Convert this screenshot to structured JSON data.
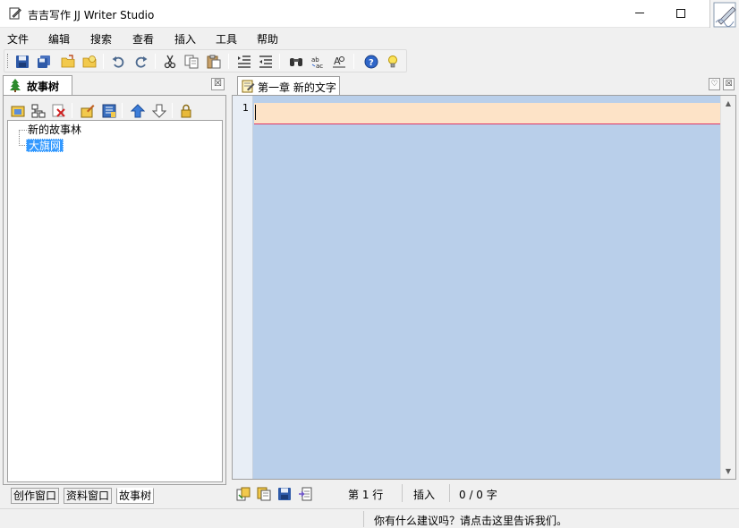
{
  "window": {
    "title": "吉吉写作 JJ Writer Studio",
    "minimize_glyph": "",
    "maximize_glyph": ""
  },
  "menu": [
    "文件",
    "编辑",
    "搜索",
    "查看",
    "插入",
    "工具",
    "帮助"
  ],
  "toolbar": {
    "buttons": [
      "save-icon",
      "save-all-icon",
      "open-folder-icon",
      "close-folder-icon",
      "undo-icon",
      "redo-icon",
      "cut-icon",
      "copy-icon",
      "paste-icon",
      "indent-icon",
      "outdent-icon",
      "find-icon",
      "replace-icon",
      "find-next-icon",
      "help-icon",
      "tip-icon"
    ]
  },
  "story_tree": {
    "tab_label": "故事树",
    "close_glyph": "☒",
    "tools": [
      "add-node-icon",
      "add-child-node-icon",
      "delete-node-icon",
      "edit-node-icon",
      "properties-icon",
      "move-up-icon",
      "move-down-icon",
      "lock-icon"
    ],
    "items": [
      {
        "label": "新的故事林",
        "selected": false
      },
      {
        "label": "大旗网",
        "selected": true
      }
    ],
    "bottom_tabs": [
      "创作窗口",
      "资料窗口",
      "故事树"
    ],
    "active_bottom_tab": "故事树"
  },
  "editor": {
    "tab_label": "第一章 新的文字",
    "tab_icon": "chapter-doc-icon",
    "pin_glyph": "♡",
    "close_glyph": "☒",
    "line_number": "1",
    "scroll_up": "▲",
    "scroll_down": "▼",
    "status_buttons": [
      "word-count-icon",
      "paste-text-icon",
      "save-doc-icon",
      "export-doc-icon"
    ],
    "line_label": "第 1 行",
    "mode_label": "插入",
    "char_count": "0 / 0 字"
  },
  "statusbar": {
    "message": "你有什么建议吗？请点击这里告诉我们。"
  },
  "colors": {
    "editor_bg": "#b9cfea",
    "current_line": "#fde3c7",
    "selection": "#3399ff"
  }
}
